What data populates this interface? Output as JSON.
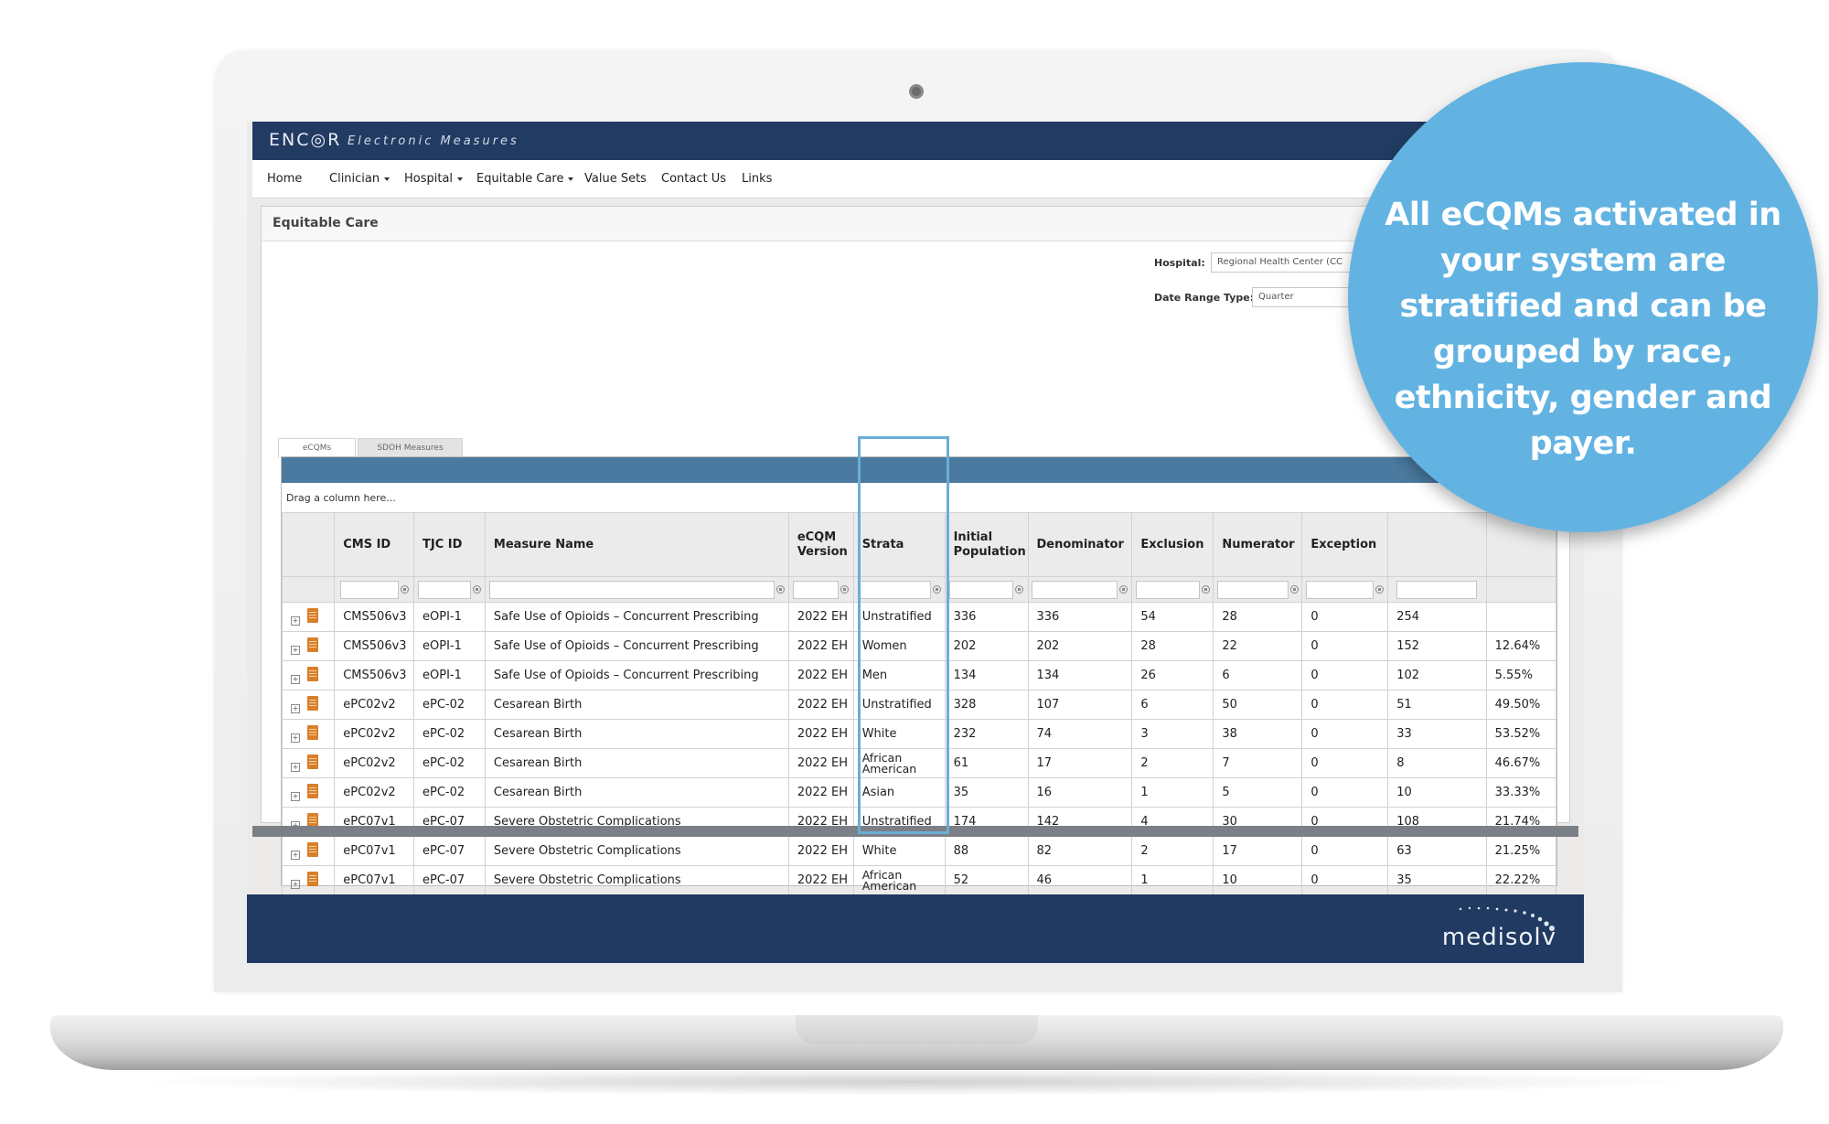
{
  "app": {
    "brand": "ENC◎R",
    "subtitle": "Electronic Measures"
  },
  "nav": {
    "items": [
      {
        "label": "Home",
        "dropdown": false
      },
      {
        "label": "Clinician",
        "dropdown": true
      },
      {
        "label": "Hospital",
        "dropdown": true
      },
      {
        "label": "Equitable Care",
        "dropdown": true
      },
      {
        "label": "Value Sets",
        "dropdown": false
      },
      {
        "label": "Contact Us",
        "dropdown": false
      },
      {
        "label": "Links",
        "dropdown": false
      }
    ]
  },
  "panel": {
    "title": "Equitable Care",
    "hospital_label": "Hospital:",
    "hospital_value": "Regional Health Center (CC",
    "date_range_label": "Date Range Type:",
    "date_range_value": "Quarter"
  },
  "tabs": [
    {
      "label": "eCQMs",
      "active": true
    },
    {
      "label": "SDOH Measures",
      "active": false
    }
  ],
  "grid": {
    "drag_hint": "Drag a column here...",
    "columns": [
      "CMS ID",
      "TJC ID",
      "Measure Name",
      "eCQM Version",
      "Strata",
      "Initial Population",
      "Denominator",
      "Exclusion",
      "Numerator",
      "Exception",
      "",
      ""
    ],
    "rows": [
      {
        "cms": "CMS506v3",
        "tjc": "eOPI-1",
        "measure": "Safe Use of Opioids – Concurrent Prescribing",
        "version": "2022 EH",
        "strata": "Unstratified",
        "ip": "336",
        "den": "336",
        "excl": "54",
        "num": "28",
        "exc": "0",
        "c11": "254",
        "c12": ""
      },
      {
        "cms": "CMS506v3",
        "tjc": "eOPI-1",
        "measure": "Safe Use of Opioids – Concurrent Prescribing",
        "version": "2022 EH",
        "strata": "Women",
        "ip": "202",
        "den": "202",
        "excl": "28",
        "num": "22",
        "exc": "0",
        "c11": "152",
        "c12": "12.64%"
      },
      {
        "cms": "CMS506v3",
        "tjc": "eOPI-1",
        "measure": "Safe Use of Opioids – Concurrent Prescribing",
        "version": "2022 EH",
        "strata": "Men",
        "ip": "134",
        "den": "134",
        "excl": "26",
        "num": "6",
        "exc": "0",
        "c11": "102",
        "c12": "5.55%"
      },
      {
        "cms": "ePC02v2",
        "tjc": "ePC-02",
        "measure": "Cesarean Birth",
        "version": "2022 EH",
        "strata": "Unstratified",
        "ip": "328",
        "den": "107",
        "excl": "6",
        "num": "50",
        "exc": "0",
        "c11": "51",
        "c12": "49.50%"
      },
      {
        "cms": "ePC02v2",
        "tjc": "ePC-02",
        "measure": "Cesarean Birth",
        "version": "2022 EH",
        "strata": "White",
        "ip": "232",
        "den": "74",
        "excl": "3",
        "num": "38",
        "exc": "0",
        "c11": "33",
        "c12": "53.52%"
      },
      {
        "cms": "ePC02v2",
        "tjc": "ePC-02",
        "measure": "Cesarean Birth",
        "version": "2022 EH",
        "strata": "African American",
        "ip": "61",
        "den": "17",
        "excl": "2",
        "num": "7",
        "exc": "0",
        "c11": "8",
        "c12": "46.67%"
      },
      {
        "cms": "ePC02v2",
        "tjc": "ePC-02",
        "measure": "Cesarean Birth",
        "version": "2022 EH",
        "strata": "Asian",
        "ip": "35",
        "den": "16",
        "excl": "1",
        "num": "5",
        "exc": "0",
        "c11": "10",
        "c12": "33.33%"
      },
      {
        "cms": "ePC07v1",
        "tjc": "ePC-07",
        "measure": "Severe Obstetric Complications",
        "version": "2022 EH",
        "strata": "Unstratified",
        "ip": "174",
        "den": "142",
        "excl": "4",
        "num": "30",
        "exc": "0",
        "c11": "108",
        "c12": "21.74%"
      },
      {
        "cms": "ePC07v1",
        "tjc": "ePC-07",
        "measure": "Severe Obstetric Complications",
        "version": "2022 EH",
        "strata": "White",
        "ip": "88",
        "den": "82",
        "excl": "2",
        "num": "17",
        "exc": "0",
        "c11": "63",
        "c12": "21.25%"
      },
      {
        "cms": "ePC07v1",
        "tjc": "ePC-07",
        "measure": "Severe Obstetric Complications",
        "version": "2022 EH",
        "strata": "African American",
        "ip": "52",
        "den": "46",
        "excl": "1",
        "num": "10",
        "exc": "0",
        "c11": "35",
        "c12": "22.22%"
      }
    ]
  },
  "footer": {
    "logo_text": "medisolv"
  },
  "callout": {
    "text": "All eCQMs activated in your system are stratified and can be grouped by race, ethnicity, gender and payer."
  },
  "colors": {
    "header_navy": "#213b62",
    "grid_bar": "#4a7aa0",
    "callout_blue": "#63b3e2",
    "strata_highlight": "#6aaed6",
    "doc_icon": "#d97f2a"
  }
}
